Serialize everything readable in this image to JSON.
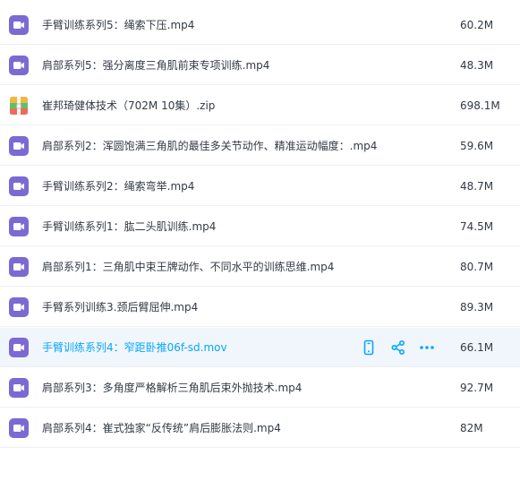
{
  "files": [
    {
      "name": "手臂训练系列5：绳索下压.mp4",
      "size": "60.2M",
      "type": "video-icon"
    },
    {
      "name": "肩部系列5：强分离度三角肌前束专项训练.mp4",
      "size": "48.3M",
      "type": "video-icon"
    },
    {
      "name": "崔邦琦健体技术（702M 10集）.zip",
      "size": "698.1M",
      "type": "zip-icon"
    },
    {
      "name": "肩部系列2：浑圆饱满三角肌的最佳多关节动作、精准运动幅度：.mp4",
      "size": "59.6M",
      "type": "video-icon"
    },
    {
      "name": "手臂训练系列2：绳索弯举.mp4",
      "size": "48.7M",
      "type": "video-icon"
    },
    {
      "name": "手臂训练系列1：肱二头肌训练.mp4",
      "size": "74.5M",
      "type": "video-icon"
    },
    {
      "name": "肩部系列1：三角肌中束王牌动作、不同水平的训练思维.mp4",
      "size": "80.7M",
      "type": "video-icon"
    },
    {
      "name": "手臂系列训练3.颈后臂屈伸.mp4",
      "size": "89.3M",
      "type": "video-icon"
    },
    {
      "name": "手臂训练系列4：窄距卧推06f-sd.mov",
      "size": "66.1M",
      "type": "video-icon",
      "hover": true
    },
    {
      "name": "肩部系列3：多角度严格解析三角肌后束外抛技术.mp4",
      "size": "92.7M",
      "type": "video-icon"
    },
    {
      "name": "肩部系列4：崔式独家“反传统”肩后膨胀法则.mp4",
      "size": "82M",
      "type": "video-icon"
    }
  ],
  "row_actions": [
    "phone-icon",
    "share-icon",
    "more-icon"
  ],
  "colors": {
    "accent": "#06a7ff",
    "video_icon": "#7b6ad4",
    "hover_bg": "#f1f6fd",
    "text": "#333a44"
  }
}
